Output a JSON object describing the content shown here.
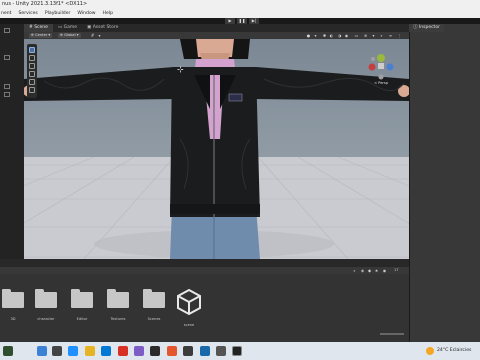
{
  "window": {
    "title": "nus - Unity 2021.3.13f1* <DX11>"
  },
  "menu": [
    "nent",
    "Services",
    "Playbuilder",
    "Window",
    "Help"
  ],
  "toolbar": {
    "play_icon": "play-icon",
    "pause_icon": "pause-icon",
    "step_icon": "step-icon"
  },
  "tabs": {
    "scene": "Scene",
    "game": "Game",
    "asset_store": "Asset Store"
  },
  "scene_toolbar": {
    "shading_mode": "Center",
    "pivot_mode": "Global"
  },
  "gizmo": {
    "projection": "< Persp"
  },
  "inspector": {
    "tab": "Inspector"
  },
  "project": {
    "items": [
      {
        "name": "3D",
        "kind": "folder"
      },
      {
        "name": "character",
        "kind": "folder"
      },
      {
        "name": "Editor",
        "kind": "folder"
      },
      {
        "name": "Textures",
        "kind": "folder"
      },
      {
        "name": "Scenes",
        "kind": "folder"
      },
      {
        "name": "scene",
        "kind": "unity-scene"
      }
    ],
    "item_count": "17"
  },
  "taskbar": {
    "weather": "24°C Eclaircies",
    "time": ""
  },
  "colors": {
    "jacket": "#1b1c1e",
    "sweater": "#d3a2cf",
    "jeans": "#6f8cad",
    "skin": "#d9a993",
    "hair": "#151515",
    "floor": "#c9cbd0"
  }
}
